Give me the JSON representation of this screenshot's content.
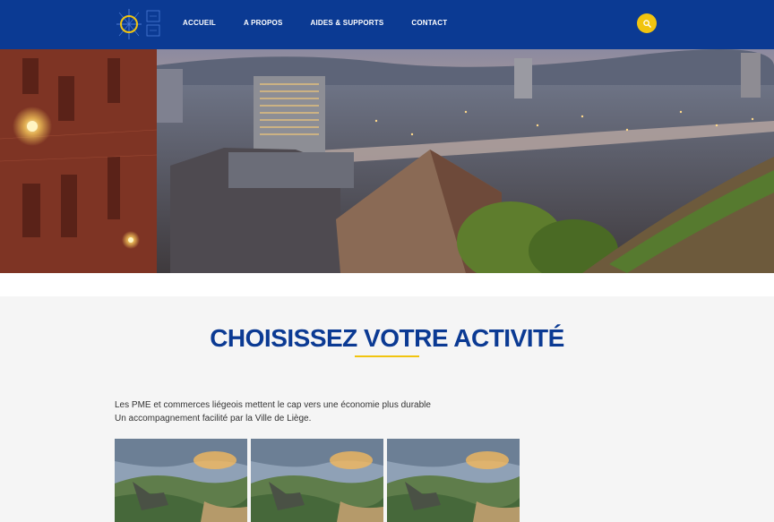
{
  "nav": {
    "items": [
      {
        "label": "ACCUEIL"
      },
      {
        "label": "A PROPOS"
      },
      {
        "label": "AIDES & SUPPORTS"
      },
      {
        "label": "CONTACT"
      }
    ],
    "search_icon": "search-icon"
  },
  "colors": {
    "brand_blue": "#0b3a93",
    "accent_yellow": "#f1c40f"
  },
  "section": {
    "title": "CHOISISSEZ VOTRE ACTIVITÉ",
    "intro_line1": "Les PME et commerces liégeois mettent le cap vers une économie plus durable",
    "intro_line2": "Un accompagnement facilité par la Ville de Liège."
  }
}
